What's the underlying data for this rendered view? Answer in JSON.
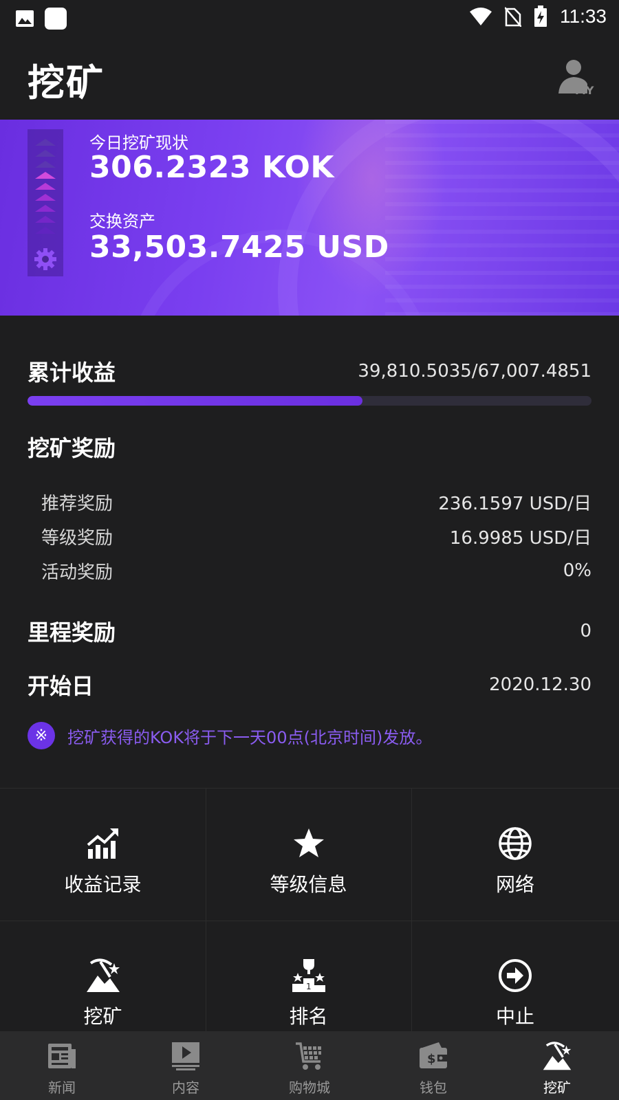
{
  "status_bar": {
    "time": "11:33"
  },
  "header": {
    "title": "挖矿",
    "avatar_tag": "MY"
  },
  "banner": {
    "today_label": "今日挖矿现状",
    "today_value": "306.2323 KOK",
    "assets_label": "交换资产",
    "assets_value": "33,503.7425 USD"
  },
  "earnings": {
    "label": "累计收益",
    "value": "39,810.5035/67,007.4851",
    "progress": 0.594
  },
  "rewards": {
    "title": "挖矿奖励",
    "items": [
      {
        "label": "推荐奖励",
        "value": "236.1597 USD/日"
      },
      {
        "label": "等级奖励",
        "value": "16.9985 USD/日"
      },
      {
        "label": "活动奖励",
        "value": "0%"
      }
    ]
  },
  "mileage": {
    "label": "里程奖励",
    "value": "0"
  },
  "start_date": {
    "label": "开始日",
    "value": "2020.12.30"
  },
  "notice": {
    "icon": "※",
    "text": "挖矿获得的KOK将于下一天00点(北京时间)发放。"
  },
  "menu": [
    {
      "label": "收益记录",
      "icon": "chart-up-icon"
    },
    {
      "label": "等级信息",
      "icon": "star-icon"
    },
    {
      "label": "网络",
      "icon": "globe-icon"
    },
    {
      "label": "挖矿",
      "icon": "mining-icon"
    },
    {
      "label": "排名",
      "icon": "trophy-icon"
    },
    {
      "label": "中止",
      "icon": "arrow-circle-icon"
    }
  ],
  "tabs": [
    {
      "label": "新闻",
      "icon": "news-icon"
    },
    {
      "label": "内容",
      "icon": "video-icon"
    },
    {
      "label": "购物城",
      "icon": "cart-icon"
    },
    {
      "label": "钱包",
      "icon": "wallet-icon"
    },
    {
      "label": "挖矿",
      "icon": "mining-icon",
      "active": true
    }
  ],
  "colors": {
    "accent": "#7a3ff0",
    "background": "#1e1e1f",
    "notice_text": "#8a5cf0"
  }
}
